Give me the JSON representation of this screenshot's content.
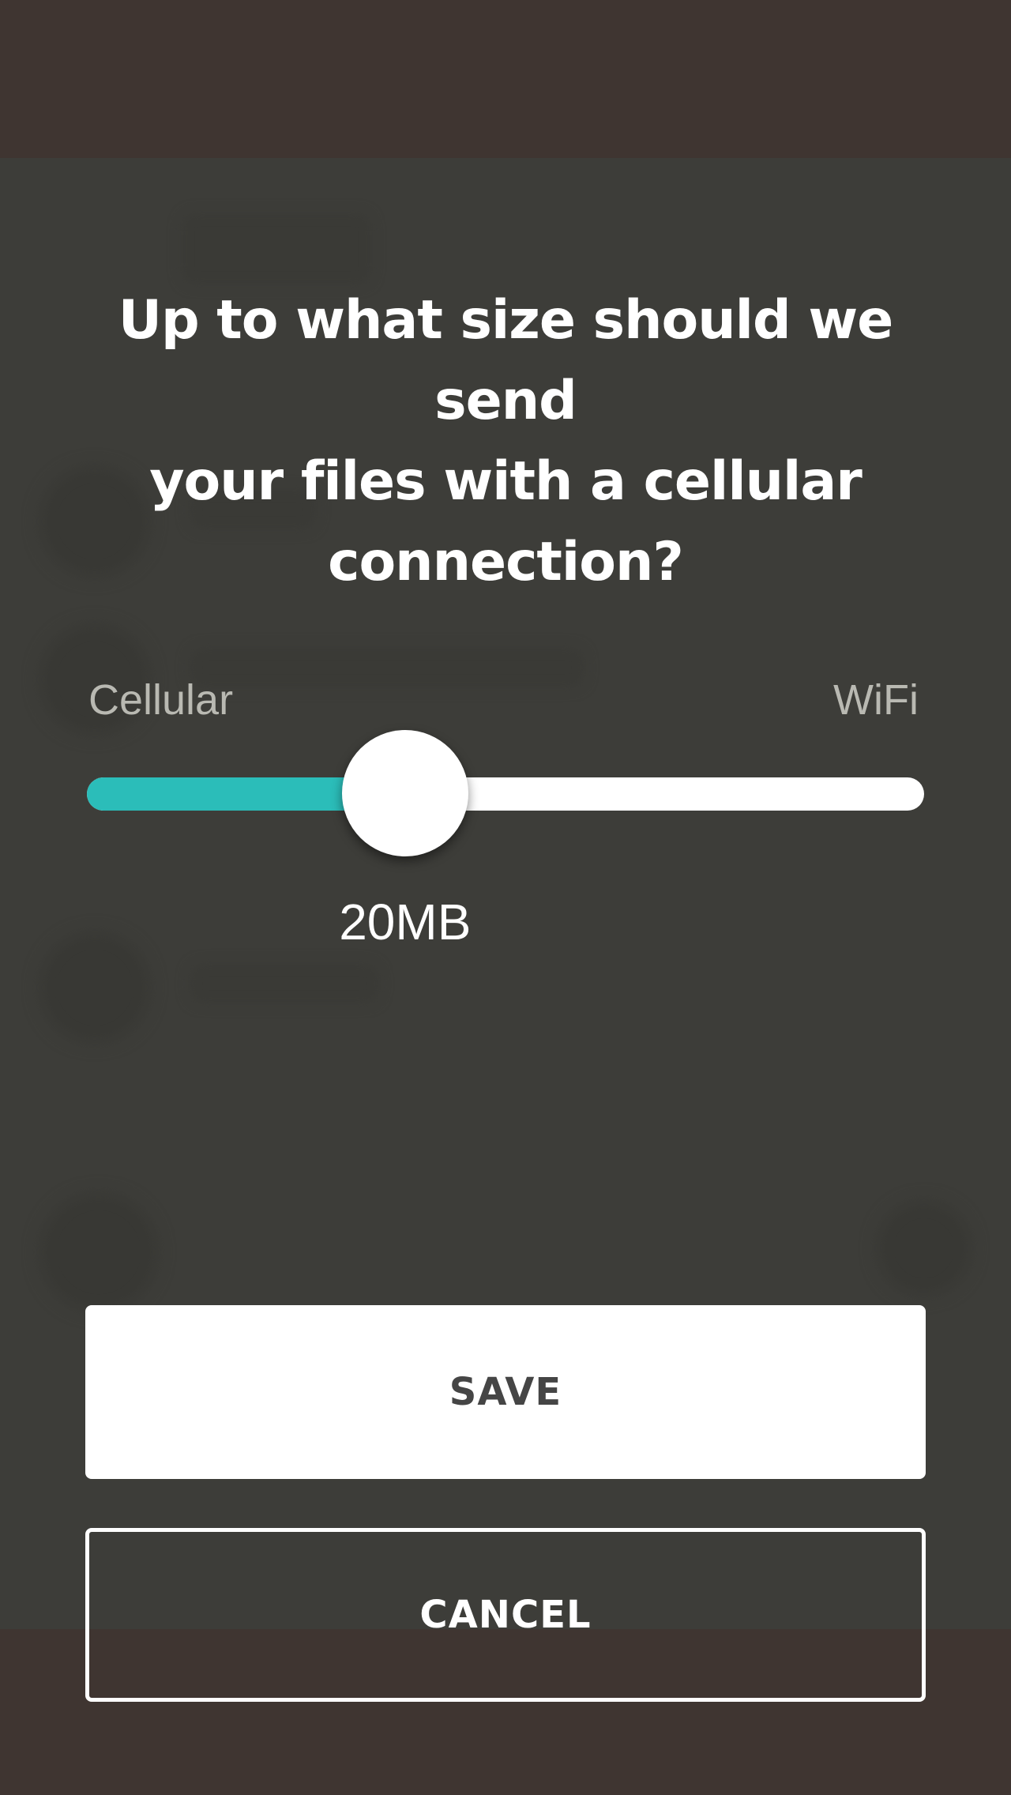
{
  "dialog": {
    "title_line1": "Up to what size should we send",
    "title_line2": "your files with a cellular",
    "title_line3": "connection?"
  },
  "slider": {
    "min_label": "Cellular",
    "max_label": "WiFi",
    "value_label": "20MB",
    "fill_fraction": 0.38,
    "fill_color": "#2bbdb9",
    "track_color": "#ffffff"
  },
  "actions": {
    "save_label": "SAVE",
    "cancel_label": "CANCEL"
  }
}
